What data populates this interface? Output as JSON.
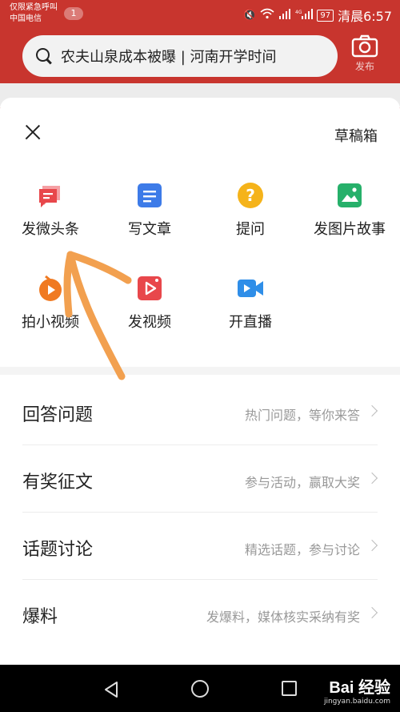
{
  "status_bar": {
    "carrier_line1": "仅限紧急呼叫",
    "carrier_line2": "中国电信",
    "notification_count": "1",
    "battery": "97",
    "time": "清晨6:57"
  },
  "header": {
    "search_text": "农夫山泉成本被曝 | 河南开学时间",
    "publish_label": "发布"
  },
  "sheet": {
    "drafts_label": "草稿箱",
    "grid_items": [
      {
        "label": "发微头条",
        "icon": "micro-post-icon",
        "color": "#e8474b"
      },
      {
        "label": "写文章",
        "icon": "article-icon",
        "color": "#3d7be8"
      },
      {
        "label": "提问",
        "icon": "question-icon",
        "color": "#f5b31a"
      },
      {
        "label": "发图片故事",
        "icon": "photo-story-icon",
        "color": "#26b06a"
      },
      {
        "label": "拍小视频",
        "icon": "short-video-icon",
        "color": "#f07a22"
      },
      {
        "label": "发视频",
        "icon": "video-icon",
        "color": "#e8474b"
      },
      {
        "label": "开直播",
        "icon": "live-icon",
        "color": "#2f8ee8"
      }
    ],
    "list_items": [
      {
        "title": "回答问题",
        "subtitle": "热门问题，等你来答"
      },
      {
        "title": "有奖征文",
        "subtitle": "参与活动，赢取大奖"
      },
      {
        "title": "话题讨论",
        "subtitle": "精选话题，参与讨论"
      },
      {
        "title": "爆料",
        "subtitle": "发爆料，媒体核实采纳有奖"
      }
    ]
  },
  "watermark": {
    "logo": "Bai 经验",
    "url": "jingyan.baidu.com"
  },
  "colors": {
    "brand_red": "#c8352e",
    "annotation_orange": "#f2a04f"
  }
}
